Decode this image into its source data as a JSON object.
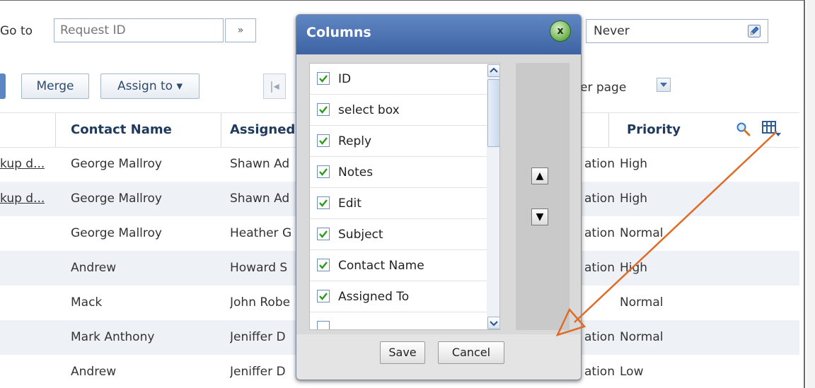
{
  "toolbar": {
    "goto_label": "Go to",
    "goto_placeholder": "Request ID",
    "goto_button": "»",
    "never_value": "Never",
    "merge_label": "Merge",
    "assign_label": "Assign to ▾",
    "nav_first": "|◂",
    "per_page_label": "er page"
  },
  "table": {
    "headers": {
      "contact": "Contact Name",
      "assigned": "Assigned To",
      "priority": "Priority"
    },
    "rows": [
      {
        "subject": "kup d...",
        "subject_link": true,
        "contact": "George Mallroy",
        "assigned": "Shawn Ad",
        "status": "ation",
        "priority": "High"
      },
      {
        "subject": "kup d...",
        "subject_link": true,
        "contact": "George Mallroy",
        "assigned": "Shawn Ad",
        "status": "ation",
        "priority": "High"
      },
      {
        "subject": "",
        "subject_link": false,
        "contact": "George Mallroy",
        "assigned": "Heather G",
        "status": "ation",
        "priority": "Normal"
      },
      {
        "subject": "",
        "subject_link": false,
        "contact": "Andrew",
        "assigned": "Howard S",
        "status": "ation",
        "priority": "High"
      },
      {
        "subject": "",
        "subject_link": false,
        "contact": "Mack",
        "assigned": "John Robe",
        "status": "",
        "priority": "Normal"
      },
      {
        "subject": "",
        "subject_link": false,
        "contact": "Mark Anthony",
        "assigned": "Jeniffer D",
        "status": "ation",
        "priority": "Normal"
      },
      {
        "subject": "",
        "subject_link": false,
        "contact": "Andrew",
        "assigned": "Jeniffer D",
        "status": "ation",
        "priority": "Low"
      }
    ]
  },
  "dialog": {
    "title": "Columns",
    "close": "x",
    "items": [
      {
        "label": "ID",
        "checked": true
      },
      {
        "label": "select box",
        "checked": true
      },
      {
        "label": "Reply",
        "checked": true
      },
      {
        "label": "Notes",
        "checked": true
      },
      {
        "label": "Edit",
        "checked": true
      },
      {
        "label": "Subject",
        "checked": true
      },
      {
        "label": "Contact Name",
        "checked": true
      },
      {
        "label": "Assigned To",
        "checked": true
      }
    ],
    "move_up": "▲",
    "move_down": "▼",
    "save": "Save",
    "cancel": "Cancel"
  },
  "colors": {
    "accent": "#3e62a2",
    "annotation_arrow": "#e06a26",
    "row_alt": "#eef2f6"
  }
}
